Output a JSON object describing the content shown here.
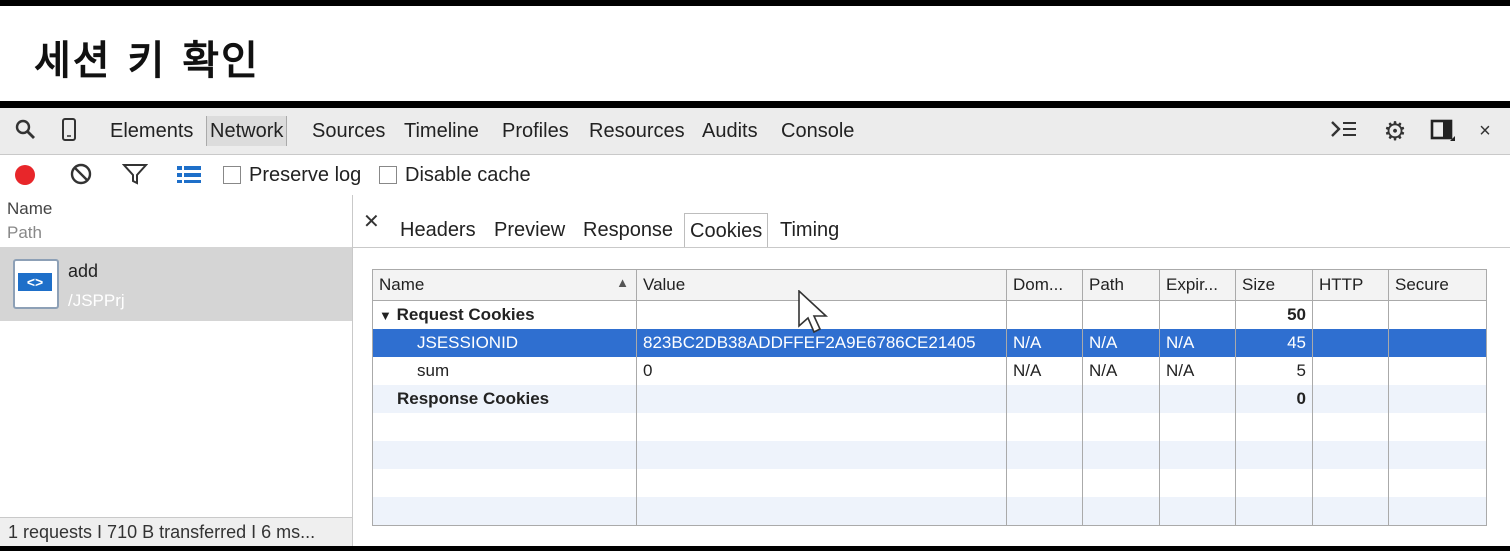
{
  "slide": {
    "title": "세션 키 확인"
  },
  "devtools": {
    "tabs": [
      "Elements",
      "Network",
      "Sources",
      "Timeline",
      "Profiles",
      "Resources",
      "Audits",
      "Console"
    ],
    "active_tab": "Network",
    "toolbar": {
      "preserve_log": "Preserve log",
      "disable_cache": "Disable cache"
    },
    "requests": {
      "header_name": "Name",
      "header_path": "Path",
      "items": [
        {
          "name": "add",
          "path": "/JSPPrj"
        }
      ],
      "status": "1 requests I 710 B transferred I 6 ms..."
    },
    "detail_tabs": [
      "Headers",
      "Preview",
      "Response",
      "Cookies",
      "Timing"
    ],
    "active_detail_tab": "Cookies",
    "cookies": {
      "columns": [
        "Name",
        "Value",
        "Dom...",
        "Path",
        "Expir...",
        "Size",
        "HTTP",
        "Secure"
      ],
      "request_group": {
        "label": "Request Cookies",
        "size": "50"
      },
      "request_rows": [
        {
          "name": "JSESSIONID",
          "value": "823BC2DB38ADDFFEF2A9E6786CE21405",
          "domain": "N/A",
          "path": "N/A",
          "expires": "N/A",
          "size": "45"
        },
        {
          "name": "sum",
          "value": "0",
          "domain": "N/A",
          "path": "N/A",
          "expires": "N/A",
          "size": "5"
        }
      ],
      "response_group": {
        "label": "Response Cookies",
        "size": "0"
      }
    },
    "colors": {
      "record": "#e8262a",
      "selection": "#2f6fd0"
    }
  }
}
